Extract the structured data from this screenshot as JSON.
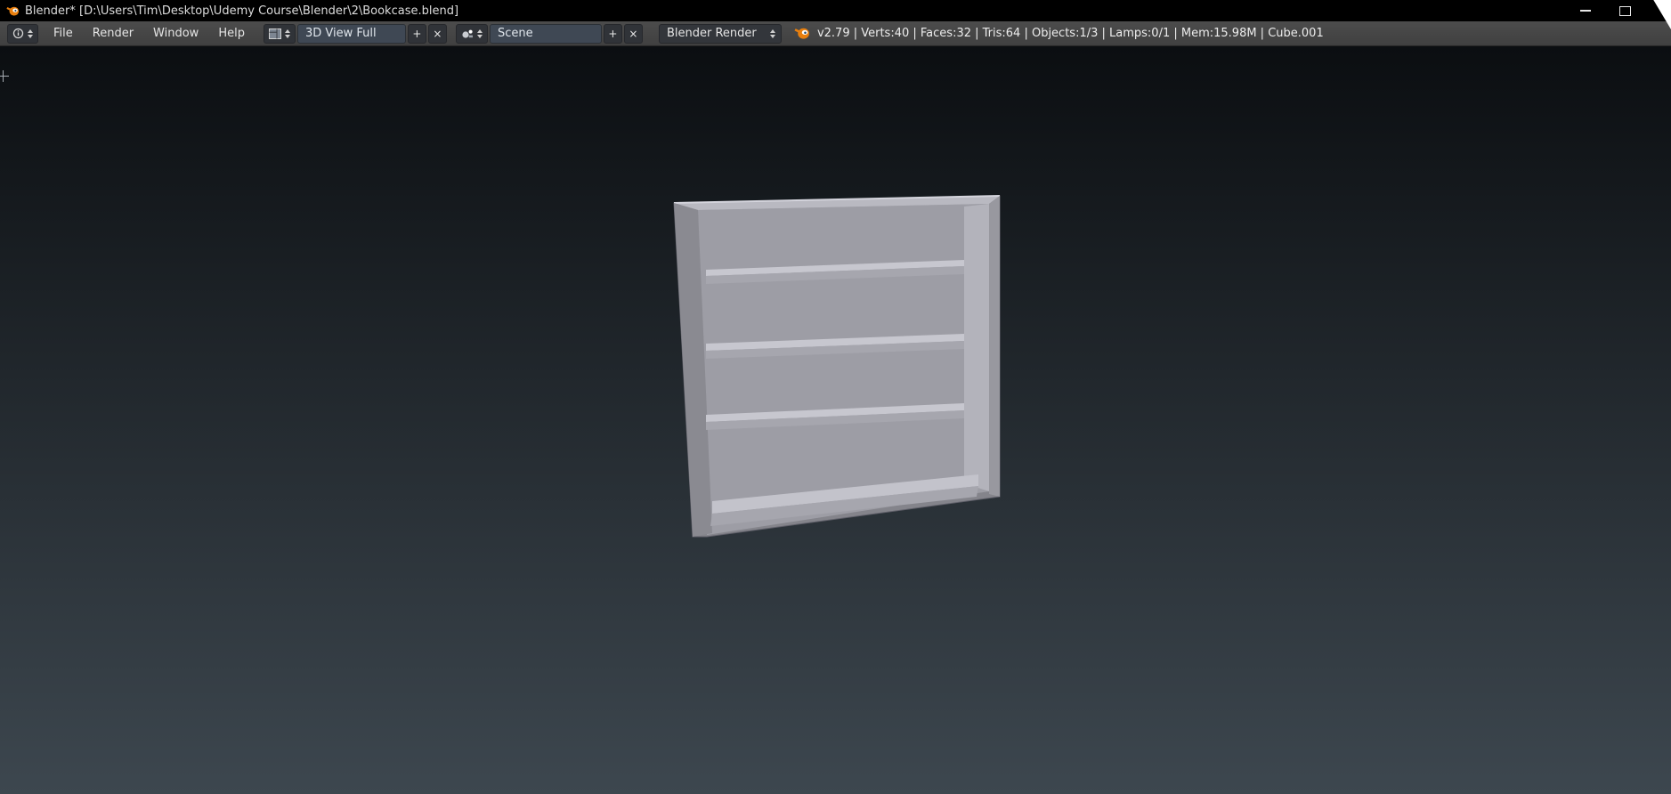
{
  "window": {
    "title": "Blender* [D:\\Users\\Tim\\Desktop\\Udemy Course\\Blender\\2\\Bookcase.blend]"
  },
  "header": {
    "menus": [
      "File",
      "Render",
      "Window",
      "Help"
    ],
    "layout_field": {
      "value": "3D View Full"
    },
    "scene_field": {
      "value": "Scene"
    },
    "engine_field": {
      "value": "Blender Render"
    },
    "add_label": "+",
    "remove_label": "×",
    "stats": "v2.79 | Verts:40 | Faces:32 | Tris:64 | Objects:1/3 | Lamps:0/1 | Mem:15.98M | Cube.001"
  },
  "colors": {
    "blender_orange": "#e87f0e",
    "header_bg": "#454545",
    "viewport_top": "#0b0e11",
    "viewport_bottom": "#3d474f",
    "bookcase_light": "#c7c7cf",
    "bookcase_mid": "#9d9da5",
    "bookcase_dark": "#84848b"
  }
}
